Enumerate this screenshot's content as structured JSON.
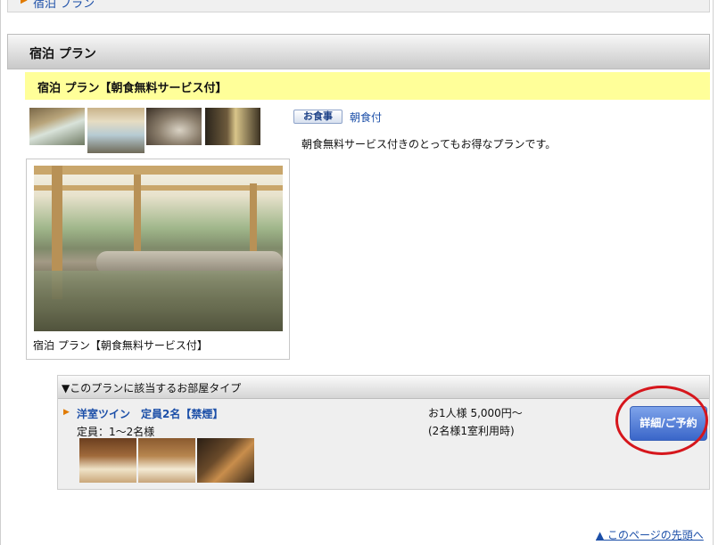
{
  "top_link": {
    "label": "宿泊 プラン"
  },
  "section": {
    "title": "宿泊 プラン"
  },
  "plan": {
    "title": "宿泊 プラン【朝食無料サービス付】",
    "meal_badge": "お食事",
    "meal_value": "朝食付",
    "description": "朝食無料サービス付きのとってもお得なプランです。",
    "photo_caption": "宿泊 プラン【朝食無料サービス付】"
  },
  "rooms": {
    "header": "▼このプランに該当するお部屋タイプ",
    "items": [
      {
        "name": "洋室ツイン　定員2名【禁煙】",
        "capacity": "定員：1～2名様",
        "price": "お1人様 5,000円～",
        "price_note": "(2名様1室利用時)",
        "button_label": "詳細/ご予約"
      }
    ]
  },
  "footer": {
    "page_top_label": "▲ このページの先頭へ"
  },
  "colors": {
    "accent": "#1c4fa8",
    "plan_bar": "#ffff99",
    "annotation": "#d6161c"
  }
}
